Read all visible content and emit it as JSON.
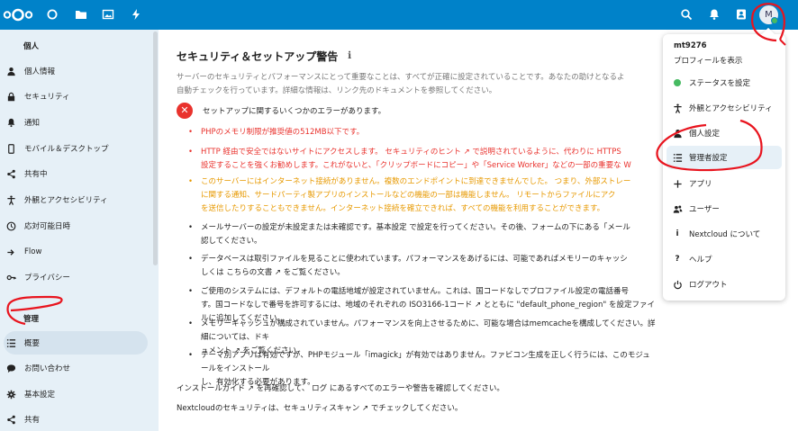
{
  "header": {
    "nav_icons": [
      "dashboard-icon",
      "files-icon",
      "photos-icon",
      "activity-icon"
    ],
    "right_icons": [
      "search-icon",
      "notifications-icon",
      "contacts-icon"
    ],
    "avatar_letter": "M",
    "accent": "#0082c9"
  },
  "sidebar": {
    "personal_title": "個人",
    "personal_items": [
      {
        "label": "個人情報",
        "icon": "user-icon"
      },
      {
        "label": "セキュリティ",
        "icon": "lock-icon"
      },
      {
        "label": "通知",
        "icon": "bell-icon"
      },
      {
        "label": "モバイル＆デスクトップ",
        "icon": "phone-icon"
      },
      {
        "label": "共有中",
        "icon": "share-icon"
      },
      {
        "label": "外観とアクセシビリティ",
        "icon": "accessibility-icon"
      },
      {
        "label": "応対可能日時",
        "icon": "clock-icon"
      },
      {
        "label": "Flow",
        "icon": "flow-icon"
      },
      {
        "label": "プライバシー",
        "icon": "key-icon"
      }
    ],
    "admin_title": "管理",
    "admin_items": [
      {
        "label": "概要",
        "icon": "list-icon",
        "active": true
      },
      {
        "label": "お問い合わせ",
        "icon": "chat-icon"
      },
      {
        "label": "基本設定",
        "icon": "gear-icon"
      },
      {
        "label": "共有",
        "icon": "share-icon"
      }
    ]
  },
  "main": {
    "title": "セキュリティ＆セットアップ警告",
    "intro_1": "サーバーのセキュリティとパフォーマンスにとって重要なことは、すべてが正確に設定されていることです。あなたの助けとなるよ",
    "intro_2": "自動チェックを行っています。詳細な情報は、リンク先のドキュメントを参照してください。",
    "error_heading": "セットアップに関するいくつかのエラーがあります。",
    "bullets": [
      {
        "color": "red",
        "lines": [
          "PHPのメモリ制限が推奨値の512MB以下です。"
        ]
      },
      {
        "color": "red",
        "lines": [
          "HTTP 経由で安全ではないサイトにアクセスします。 セキュリティのヒント ↗ で説明されているように、代わりに HTTPS",
          "設定することを強くお勧めします。これがないと、「クリップボードにコピー」や「Service Worker」などの一部の重要な W"
        ]
      },
      {
        "color": "orange",
        "lines": [
          "このサーバーにはインターネット接続がありません。複数のエンドポイントに到達できませんでした。 つまり、外部ストレー",
          "に関する通知、サードパーティ製アプリのインストールなどの機能の一部は機能しません。 リモートからファイルにアク",
          "を送信したりすることもできません。インターネット接続を確立できれば、すべての機能を利用することができます。"
        ]
      },
      {
        "color": "dark",
        "lines": [
          "メールサーバーの設定が未設定または未確認です。基本設定 で設定を行ってください。その後、フォームの下にある「メール",
          "認してください。"
        ]
      },
      {
        "color": "dark",
        "lines": [
          "データベースは取引ファイルを見ることに使われています。パフォーマンスをあげるには、可能であればメモリーのキャッシ",
          "しくは こちらの文書 ↗ をご覧ください。"
        ]
      },
      {
        "color": "dark",
        "lines": [
          "ご使用のシステムには、デフォルトの電話地域が設定されていません。これは、国コードなしでプロファイル設定の電話番号",
          "す。国コードなしで番号を許可するには、地域のそれぞれの ISO3166-1コード ↗ とともに \"default_phone_region\" を設定ファイルに追加してください。"
        ]
      },
      {
        "color": "dark",
        "lines": [
          "メモリーキャッシュが構成されていません。パフォーマンスを向上させるために、可能な場合はmemcacheを構成してください。詳細については、ドキ",
          "ュメント ↗ をご覧ください。"
        ]
      },
      {
        "color": "dark",
        "lines": [
          "テーマ別アプリは有効ですが、PHPモジュール「imagick」が有効ではありません。ファビコン生成を正しく行うには、このモジュールをインストール",
          "し、有効化する必要があります。"
        ]
      }
    ],
    "footer_1": "インストールガイド ↗ を再確認して、 ログ にあるすべてのエラーや警告を確認してください。",
    "footer_2": "Nextcloudのセキュリティは、セキュリティスキャン ↗ でチェックしてください。"
  },
  "user_menu": {
    "username": "mt9276",
    "profile_link": "プロフィールを表示",
    "items": [
      {
        "label": "ステータスを設定",
        "icon": "status-dot-icon"
      },
      {
        "label": "外観とアクセシビリティ",
        "icon": "accessibility-icon"
      },
      {
        "label": "個人設定",
        "icon": "user-icon"
      },
      {
        "label": "管理者設定",
        "icon": "list-icon",
        "active": true
      },
      {
        "label": "アプリ",
        "icon": "plus-icon"
      },
      {
        "label": "ユーザー",
        "icon": "users-icon"
      },
      {
        "label": "Nextcloud について",
        "icon": "info-icon"
      },
      {
        "label": "ヘルプ",
        "icon": "help-icon"
      },
      {
        "label": "ログアウト",
        "icon": "power-icon"
      }
    ]
  },
  "colors": {
    "error": "#e9322d",
    "warning": "#e79900",
    "status_online": "#46ba61",
    "annotation": "#e8141e"
  }
}
